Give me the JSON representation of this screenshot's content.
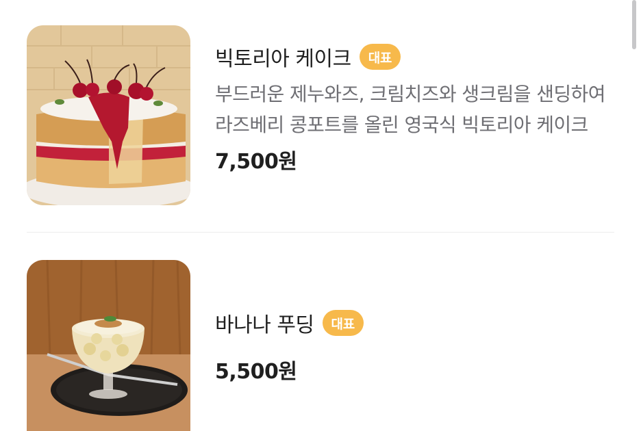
{
  "menu": {
    "items": [
      {
        "name": "빅토리아 케이크",
        "badge": "대표",
        "description": "부드러운 제누와즈, 크림치즈와 생크림을 샌딩하여 라즈베리 콩포트를 올린 영국식 빅토리아 케이크",
        "price": "7,500원",
        "image": "victoria-cake-photo"
      },
      {
        "name": "바나나 푸딩",
        "badge": "대표",
        "price": "5,500원",
        "image": "banana-pudding-photo"
      }
    ]
  },
  "colors": {
    "badge": "#f7b94b",
    "title": "#1f1f1f",
    "description": "#6e6e73",
    "divider": "#ececec"
  }
}
